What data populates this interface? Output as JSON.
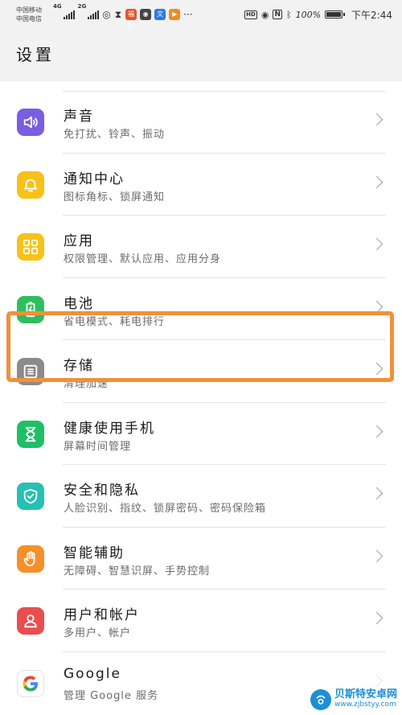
{
  "status_bar": {
    "carrier_1": "中国移动",
    "carrier_2": "中国电信",
    "network_1": "4G",
    "network_2": "2G",
    "app_badge_text": "福利",
    "more": "···",
    "hd": "HD",
    "battery": "100%",
    "time": "下午2:44",
    "battery_level": 1.0
  },
  "page": {
    "title": "设置"
  },
  "items": [
    {
      "title": "声音",
      "subtitle": "免打扰、铃声、振动",
      "icon": "speaker-icon",
      "color": "#7b5de0"
    },
    {
      "title": "通知中心",
      "subtitle": "图标角标、锁屏通知",
      "icon": "bell-icon",
      "color": "#f6c21a"
    },
    {
      "title": "应用",
      "subtitle": "权限管理、默认应用、应用分身",
      "icon": "apps-grid-icon",
      "color": "#f6c21a"
    },
    {
      "title": "电池",
      "subtitle": "省电模式、耗电排行",
      "icon": "battery-icon",
      "color": "#2fbe5e"
    },
    {
      "title": "存储",
      "subtitle": "清理加速",
      "icon": "storage-icon",
      "color": "#8b8b8b"
    },
    {
      "title": "健康使用手机",
      "subtitle": "屏幕时间管理",
      "icon": "hourglass-icon",
      "color": "#1fbf67"
    },
    {
      "title": "安全和隐私",
      "subtitle": "人脸识别、指纹、锁屏密码、密码保险箱",
      "icon": "shield-check-icon",
      "color": "#27c0b4"
    },
    {
      "title": "智能辅助",
      "subtitle": "无障碍、智慧识屏、手势控制",
      "icon": "hand-icon",
      "color": "#f4902a"
    },
    {
      "title": "用户和帐户",
      "subtitle": "多用户、帐户",
      "icon": "user-icon",
      "color": "#ea4d4d"
    },
    {
      "title": "Google",
      "subtitle": "管理 Google 服务",
      "icon": "google-icon",
      "color": "#ffffff"
    }
  ],
  "watermark": {
    "name": "贝斯特安卓网",
    "url": "www.zjbstyy.com"
  }
}
